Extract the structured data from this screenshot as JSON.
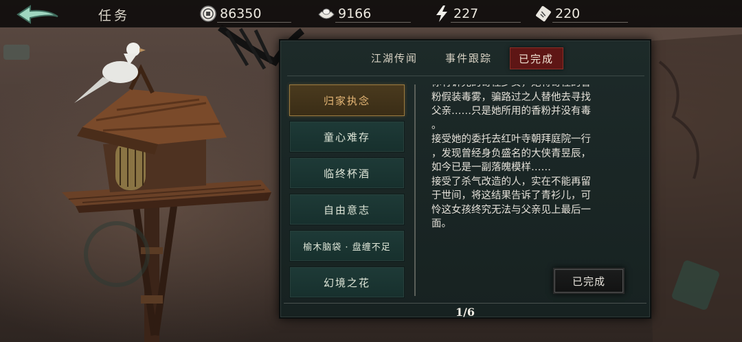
{
  "header": {
    "title": "任务",
    "coins": "86350",
    "ingots": "9166",
    "energy": "227",
    "tickets": "220"
  },
  "tabs": [
    {
      "label": "江湖传闻"
    },
    {
      "label": "事件跟踪"
    },
    {
      "label": "已完成",
      "active": true
    }
  ],
  "quests": [
    {
      "label": "归家执念",
      "selected": true
    },
    {
      "label": "童心难存"
    },
    {
      "label": "临终杯酒"
    },
    {
      "label": "自由意志"
    },
    {
      "label": "榆木脑袋 · 盘缠不足"
    },
    {
      "label": "幻境之花"
    }
  ],
  "story": {
    "line0": "你有诉允的奇怪少女，她将奇怪的香",
    "line1": "粉假装毒雾，骗路过之人替他去寻找",
    "line2": "父亲……只是她所用的香粉并没有毒",
    "line3": "。",
    "line4": "接受她的委托去红叶寺朝拜庭院一行",
    "line5": "，发现曾经身负盛名的大侠青昱辰，",
    "line6": "如今已是一副落魄模样……",
    "line7": "接受了杀气改造的人，实在不能再留",
    "line8": "于世间，将这结果告诉了青衫儿，可",
    "line9": "怜这女孩终究无法与父亲见上最后一",
    "line10": "面。"
  },
  "done_button": "已完成",
  "pager": "1/6",
  "colors": {
    "panel": "#1d2a29",
    "tab_active": "#5e1615",
    "quest_selected_text": "#e7b877",
    "quest_bg": "#1e3a37"
  },
  "icons": {
    "back": "back-arrow-icon",
    "coins": "coin-icon",
    "ingots": "silver-ingot-icon",
    "energy": "lightning-icon",
    "tickets": "ticket-icon"
  }
}
